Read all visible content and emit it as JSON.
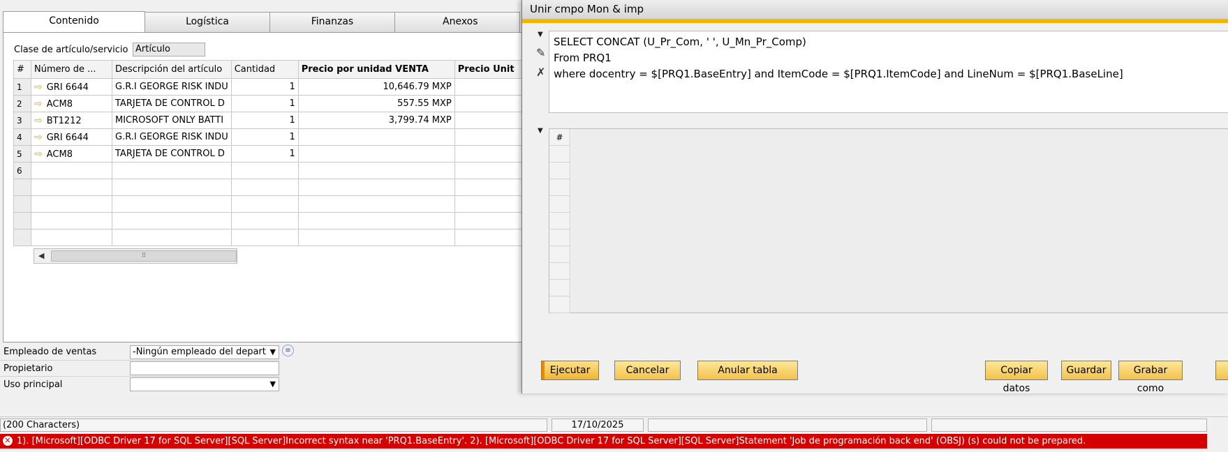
{
  "tabs": [
    "Contenido",
    "Logística",
    "Finanzas",
    "Anexos"
  ],
  "content": {
    "article_class_label": "Clase de artículo/servicio",
    "article_class_value": "Artículo",
    "grid": {
      "headers": [
        "#",
        "Número de ...",
        "Descripción del artículo",
        "Cantidad",
        "Precio por unidad VENTA",
        "Precio Unit"
      ],
      "rows": [
        {
          "n": "1",
          "code": "GRI 6644",
          "desc": "G.R.I GEORGE RISK INDU",
          "qty": "1",
          "price": "10,646.79 MXP"
        },
        {
          "n": "2",
          "code": "ACM8",
          "desc": "TARJETA DE CONTROL D",
          "qty": "1",
          "price": "557.55 MXP"
        },
        {
          "n": "3",
          "code": "BT1212",
          "desc": "MICROSOFT ONLY BATTI",
          "qty": "1",
          "price": "3,799.74 MXP"
        },
        {
          "n": "4",
          "code": "GRI 6644",
          "desc": "G.R.I GEORGE RISK INDU",
          "qty": "1",
          "price": ""
        },
        {
          "n": "5",
          "code": "ACM8",
          "desc": "TARJETA DE CONTROL D",
          "qty": "1",
          "price": ""
        },
        {
          "n": "6",
          "code": "",
          "desc": "",
          "qty": "",
          "price": ""
        }
      ]
    },
    "scroll_grip": "⠿"
  },
  "footer_fields": {
    "sales_employee_label": "Empleado de ventas",
    "sales_employee_value": "-Ningún empleado del depart",
    "owner_label": "Propietario",
    "owner_value": "",
    "main_use_label": "Uso principal",
    "main_use_value": ""
  },
  "modal": {
    "title": "Unir cmpo Mon & imp",
    "query_lines": [
      "SELECT CONCAT (U_Pr_Com, ' ', U_Mn_Pr_Comp)",
      "From PRQ1",
      "where docentry = $[PRQ1.BaseEntry] and ItemCode = $[PRQ1.ItemCode] and LineNum = $[PRQ1.BaseLine]"
    ],
    "result_header": "#",
    "buttons": {
      "execute": "Ejecutar",
      "cancel": "Cancelar",
      "cancel_table": "Anular tabla",
      "copy_data": "Copiar datos",
      "save": "Guardar",
      "save_as": "Grabar como"
    }
  },
  "status": {
    "chars": "(200 Characters)",
    "date": "17/10/2025"
  },
  "error": {
    "message": "1). [Microsoft][ODBC Driver 17 for SQL Server][SQL Server]Incorrect syntax near 'PRQ1.BaseEntry'. 2). [Microsoft][ODBC Driver 17 for SQL Server][SQL Server]Statement 'Job de programación back end' (OBSJ) (s) could not be prepared."
  },
  "icons": {
    "arrow": "⇨",
    "dropdown": "▼",
    "collapse": "▼",
    "pencil": "✎",
    "tools": "✗",
    "info": "≡",
    "error": "✕",
    "left": "◀"
  },
  "colors": {
    "accent": "#f5b400",
    "error": "#d40000",
    "button": "#f3c24a"
  }
}
